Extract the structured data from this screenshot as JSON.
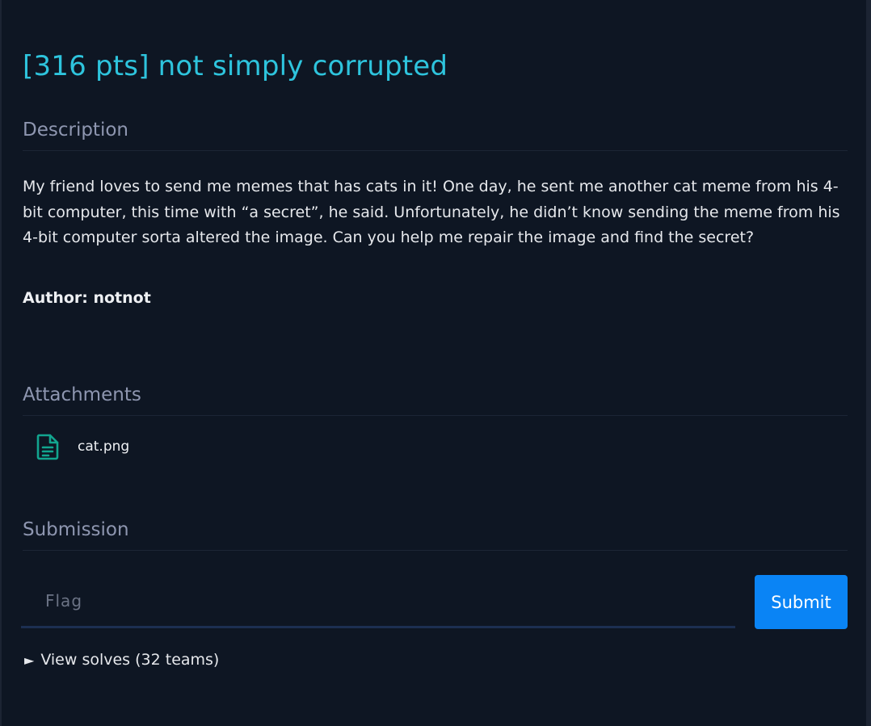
{
  "challenge": {
    "title": "[316 pts] not simply corrupted"
  },
  "description": {
    "heading": "Description",
    "text": "My friend loves to send me memes that has cats in it! One day, he sent me another cat meme from his 4-bit computer, this time with “a secret”, he said. Unfortunately, he didn’t know sending the meme from his 4-bit computer sorta altered the image. Can you help me repair the image and find the secret?",
    "author": "Author: notnot"
  },
  "attachments": {
    "heading": "Attachments",
    "files": [
      {
        "name": "cat.png",
        "icon": "file-text-icon"
      }
    ]
  },
  "submission": {
    "heading": "Submission",
    "placeholder": "Flag",
    "value": "",
    "submit_label": "Submit"
  },
  "solves": {
    "arrow": "►",
    "label": "View solves (32 teams)"
  },
  "colors": {
    "background": "#0e1623",
    "title": "#2ec4dd",
    "heading": "#8e96b0",
    "accent_button": "#0a84f5",
    "file_icon": "#12a58f"
  }
}
